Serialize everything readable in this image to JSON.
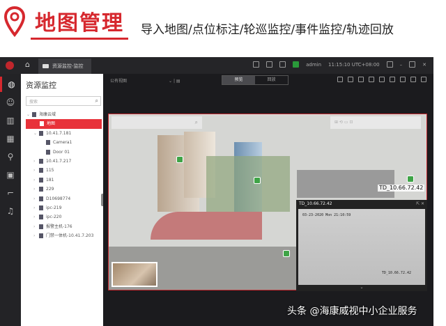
{
  "banner": {
    "title": "地图管理",
    "subtitle": "导入地图/点位标注/轮巡监控/事件监控/轨迹回放",
    "icon": "location-pin-icon"
  },
  "app": {
    "home_icon": "home-icon",
    "tab": "资源监控-监控",
    "user": "admin",
    "time": "11:15:10 UTC+08:00"
  },
  "rail": {
    "icons": [
      "globe-icon",
      "face-icon",
      "layout-icon",
      "grid-icon",
      "person-icon",
      "screen-icon",
      "camera-icon",
      "alarm-icon"
    ]
  },
  "tree": {
    "title": "资源监控",
    "search_placeholder": "搜索",
    "items": [
      {
        "label": "海康云域",
        "level": 0
      },
      {
        "label": "地图",
        "level": 1,
        "selected": true
      },
      {
        "label": "10.41.7.181",
        "level": 1
      },
      {
        "label": "Camera1",
        "level": 2
      },
      {
        "label": "Door 01",
        "level": 2
      },
      {
        "label": "10.41.7.217",
        "level": 1
      },
      {
        "label": "115",
        "level": 1
      },
      {
        "label": "181",
        "level": 1
      },
      {
        "label": "229",
        "level": 1
      },
      {
        "label": "D10698774",
        "level": 1
      },
      {
        "label": "ipc-219",
        "level": 1
      },
      {
        "label": "ipc-220",
        "level": 1
      },
      {
        "label": "报警主机-176",
        "level": 1
      },
      {
        "label": "门禁一体机-10.41.7.203",
        "level": 1
      }
    ]
  },
  "main": {
    "view_select": "公有视图",
    "mode_tabs": [
      "预览",
      "回放"
    ],
    "active_mode": "预览"
  },
  "map": {
    "marker_label": "TD_10.66.72.42"
  },
  "video": {
    "title": "TD_10.66.72.42",
    "timestamp": "03-23-2020 Mon 21:10:59",
    "camera_name": "TD_10.66.72.42"
  },
  "watermark": "头条 @海康威视中小企业服务"
}
